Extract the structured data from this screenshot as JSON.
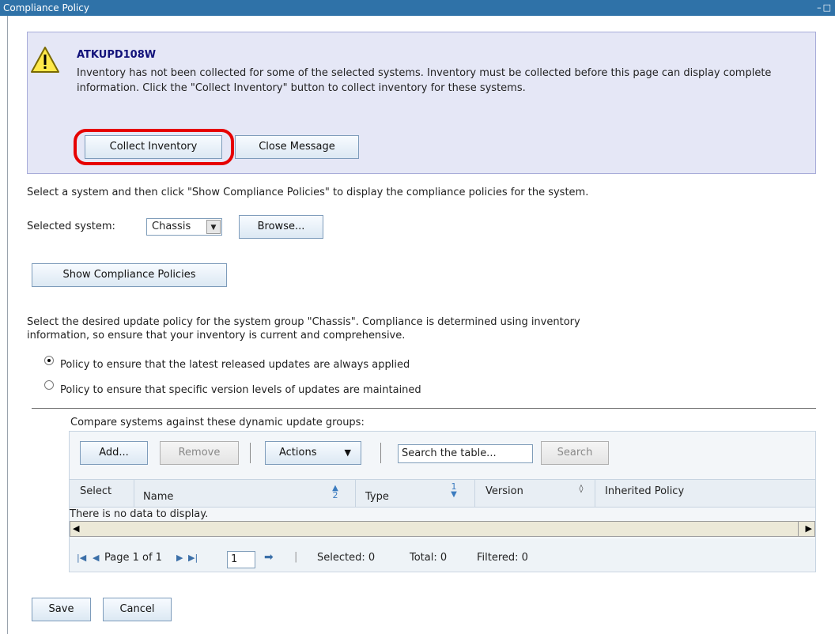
{
  "window": {
    "title": "Compliance Policy",
    "controls": "–□"
  },
  "message": {
    "id": "ATKUPD108W",
    "text": "Inventory has not been collected for some of the selected systems. Inventory must be collected before this page can display complete information. Click the \"Collect Inventory\" button to collect inventory for these systems.",
    "collect_label": "Collect Inventory",
    "close_label": "Close Message"
  },
  "system_select": {
    "instruction": "Select a system and then click \"Show Compliance Policies\" to display the compliance policies for the system.",
    "label": "Selected system:",
    "value": "Chassis",
    "browse_label": "Browse...",
    "show_label": "Show Compliance Policies"
  },
  "policy": {
    "instruction_line1": "Select the desired update policy for the system group \"Chassis\". Compliance is determined using inventory",
    "instruction_line2": "information, so ensure that your inventory is current and comprehensive.",
    "option1": "Policy to ensure that the latest released updates are always applied",
    "option2": "Policy to ensure that specific version levels of updates are maintained",
    "selected_option": 1
  },
  "groups_table": {
    "caption": "Compare systems against these dynamic update groups:",
    "add_label": "Add...",
    "remove_label": "Remove",
    "actions_label": "Actions",
    "search_value": "Search the table...",
    "search_label": "Search",
    "columns": [
      "Select",
      "Name",
      "Type",
      "Version",
      "Inherited Policy"
    ],
    "sort_name": "2",
    "sort_type": "1",
    "empty_message": "There is no data to display.",
    "page_label": "Page 1 of 1",
    "page_value": "1",
    "selected": "Selected: 0",
    "total": "Total: 0",
    "filtered": "Filtered: 0"
  },
  "footer": {
    "save_label": "Save",
    "cancel_label": "Cancel"
  }
}
